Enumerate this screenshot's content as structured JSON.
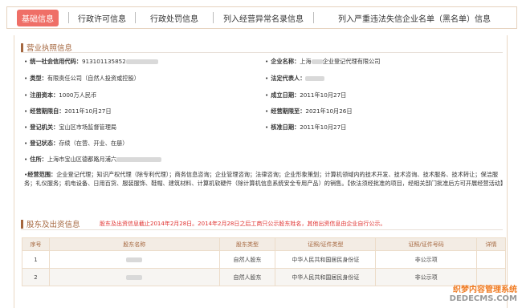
{
  "tabs": [
    {
      "label": "基础信息",
      "active": true
    },
    {
      "label": "行政许可信息"
    },
    {
      "label": "行政处罚信息"
    },
    {
      "label": "列入经营异常名录信息"
    },
    {
      "label": "列入严重违法失信企业名单（黑名单）信息"
    }
  ],
  "license": {
    "title": "营业执照信息",
    "credit_code_label": "统一社会信用代码：",
    "credit_code_value": "913101135852",
    "company_name_label": "企业名称：",
    "company_name_value": "上海",
    "company_name_suffix": "企业登记代理有限公司",
    "type_label": "类型：",
    "type_value": "有限责任公司（自然人投资或控股）",
    "legal_rep_label": "法定代表人：",
    "capital_label": "注册资本：",
    "capital_value": "1000万人民币",
    "established_label": "成立日期：",
    "established_value": "2011年10月27日",
    "period_from_label": "经营期限自：",
    "period_from_value": "2011年10月27日",
    "period_to_label": "经营期限至：",
    "period_to_value": "2021年10月26日",
    "authority_label": "登记机关：",
    "authority_value": "宝山区市场监督管理局",
    "approval_label": "核准日期：",
    "approval_value": "2011年10月27日",
    "status_label": "登记状态：",
    "status_value": "存续（在营、开业、在册）",
    "address_label": "住所：",
    "address_value": "上海市宝山区德都路月浦六",
    "scope_label": "经营范围：",
    "scope_value": "企业登记代理；知识产权代理（除专利代理）；商务信息咨询；企业管理咨询；法律咨询；企业形象策划；计算机领域内的技术开发、技术咨询、技术服务、技术转让；保洁服务；礼仪服务；机电设备、日用百货、服装服饰、鞋帽、建筑材料、计算机软硬件（除计算机信息系统安全专用产品）的销售。【依法须经批准的项目，经相关部门批准后方可开展经营活动】"
  },
  "shareholders": {
    "title": "股东及出资信息",
    "note": "股东及出资信息截止2014年2月28日。2014年2月28日之后工商只公示股东姓名，其他出资信息由企业自行公示。",
    "columns": [
      "序号",
      "股东名称",
      "股东类型",
      "证照/证件类型",
      "证照/证件号码",
      "详情"
    ],
    "rows": [
      {
        "no": "1",
        "type": "自然人股东",
        "id_type": "中华人民共和国居民身份证",
        "id_no": "非公示项",
        "detail": ""
      },
      {
        "no": "2",
        "type": "自然人股东",
        "id_type": "中华人民共和国居民身份证",
        "id_no": "非公示项",
        "detail": ""
      }
    ]
  },
  "watermark": {
    "line1": "织梦内容管理系统",
    "line2": "DEDECMS.COM"
  }
}
